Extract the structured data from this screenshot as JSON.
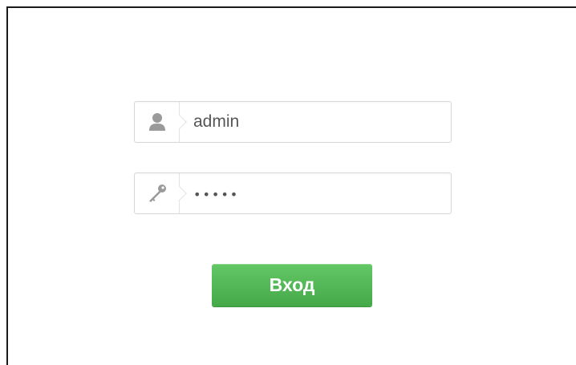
{
  "login": {
    "username": {
      "icon": "user-icon",
      "value": "admin"
    },
    "password": {
      "icon": "key-icon",
      "value": "•••••"
    },
    "submit_label": "Вход"
  },
  "colors": {
    "button_green": "#4cb050",
    "border": "#d7d7d7",
    "text": "#555555",
    "icon": "#9a9a9a"
  }
}
